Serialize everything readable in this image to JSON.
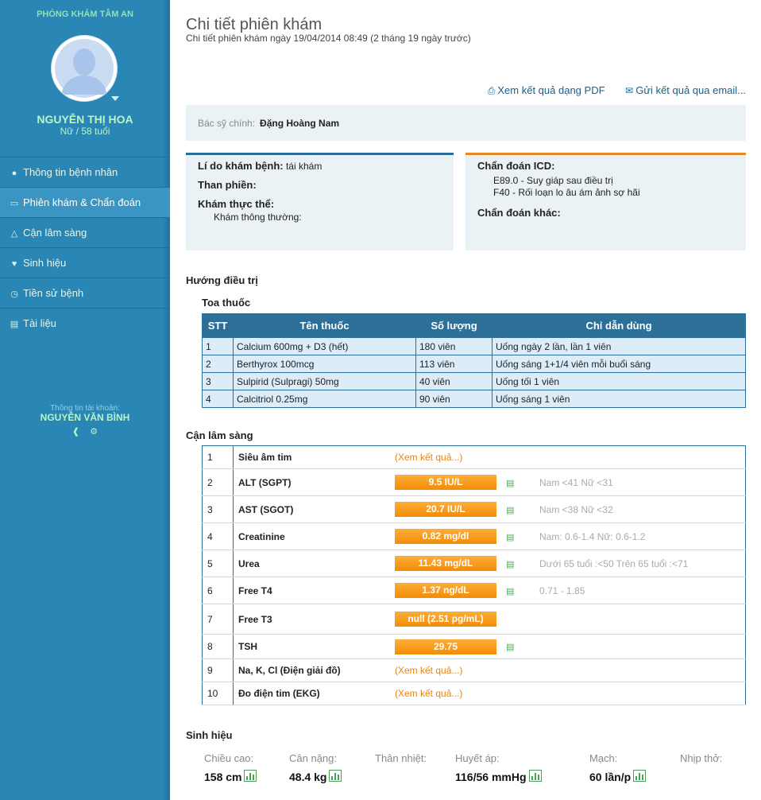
{
  "sidebar": {
    "clinic_name": "PHÒNG KHÁM TÂM AN",
    "patient_name": "NGUYỄN THỊ HOA",
    "patient_sub": "Nữ / 58 tuổi",
    "nav": [
      {
        "label": "Thông tin bệnh nhân",
        "icon": "user-icon"
      },
      {
        "label": "Phiên khám & Chẩn đoán",
        "icon": "folder-open-icon",
        "active": true
      },
      {
        "label": "Cận lâm sàng",
        "icon": "flask-icon"
      },
      {
        "label": "Sinh hiệu",
        "icon": "heart-icon"
      },
      {
        "label": "Tiền sử bệnh",
        "icon": "clock-icon"
      },
      {
        "label": "Tài liệu",
        "icon": "file-icon"
      }
    ],
    "account_label": "Thông tin tài khoản:",
    "account_name": "NGUYỄN VĂN BÌNH"
  },
  "header": {
    "title": "Chi tiết phiên khám",
    "subtitle": "Chi tiết phiên khám ngày 19/04/2014 08:49 (2 tháng 19 ngày trước)",
    "pdf_label": "Xem kết quả dạng PDF",
    "email_label": "Gửi kết quả qua email..."
  },
  "doctor": {
    "label": "Bác sỹ chính:",
    "value": "Đặng Hoàng Nam"
  },
  "exam": {
    "reason_label": "Lí do khám bệnh:",
    "reason_value": "tái khám",
    "complaint_label": "Than phiền:",
    "physical_label": "Khám thực thể:",
    "physical_value": "Khám thông thường:"
  },
  "diagnosis": {
    "icd_label": "Chẩn đoán ICD:",
    "icd_items": [
      "E89.0 - Suy giáp sau điều trị",
      "F40 - Rối loạn lo âu ám ảnh sợ hãi"
    ],
    "other_label": "Chẩn đoán khác:"
  },
  "treatment": {
    "title": "Hướng điều trị",
    "rx_title": "Toa thuốc",
    "columns": [
      "STT",
      "Tên thuốc",
      "Số lượng",
      "Chỉ dẫn dùng"
    ],
    "rows": [
      [
        "1",
        "Calcium 600mg + D3 (hết)",
        "180 viên",
        "Uống ngày 2 lần, lần 1 viên"
      ],
      [
        "2",
        "Berthyrox 100mcg",
        "113 viên",
        "Uống sáng 1+1/4 viên mỗi buổi sáng"
      ],
      [
        "3",
        "Sulpirid (Sulpragi) 50mg",
        "40 viên",
        "Uống tối 1 viên"
      ],
      [
        "4",
        "Calcitriol 0.25mg",
        "90 viên",
        "Uống sáng 1 viên"
      ]
    ]
  },
  "labs": {
    "title": "Cận lâm sàng",
    "rows": [
      {
        "stt": "1",
        "name": "Siêu âm tim",
        "link": "(Xem kết quả...)"
      },
      {
        "stt": "2",
        "name": "ALT (SGPT)",
        "result": "9.5 IU/L",
        "chart": true,
        "ref": "Nam <41 Nữ <31"
      },
      {
        "stt": "3",
        "name": "AST (SGOT)",
        "result": "20.7 IU/L",
        "chart": true,
        "ref": "Nam <38 Nữ <32"
      },
      {
        "stt": "4",
        "name": "Creatinine",
        "result": "0.82 mg/dl",
        "chart": true,
        "ref": "Nam: 0.6-1.4 Nữ: 0.6-1.2"
      },
      {
        "stt": "5",
        "name": "Urea",
        "result": "11.43 mg/dL",
        "chart": true,
        "ref": "Dưới 65 tuổi :<50 Trên 65 tuổi :<71"
      },
      {
        "stt": "6",
        "name": "Free T4",
        "result": "1.37 ng/dL",
        "chart": true,
        "ref": "0.71 - 1.85"
      },
      {
        "stt": "7",
        "name": "Free T3",
        "result": "null (2.51 pg/mL)"
      },
      {
        "stt": "8",
        "name": "TSH",
        "result": "29.75",
        "chart": true
      },
      {
        "stt": "9",
        "name": "Na, K, Cl (Điện giải đồ)",
        "link": "(Xem kết quả...)"
      },
      {
        "stt": "10",
        "name": "Đo điện tim (EKG)",
        "link": "(Xem kết quả...)"
      }
    ]
  },
  "vitals": {
    "title": "Sinh hiệu",
    "items": [
      {
        "label": "Chiều cao:",
        "value": "158 cm",
        "chart": true
      },
      {
        "label": "Cân nặng:",
        "value": "48.4 kg",
        "chart": true
      },
      {
        "label": "Thân nhiệt:",
        "value": ""
      },
      {
        "label": "Huyết áp:",
        "value": "116/56 mmHg",
        "chart": true
      },
      {
        "label": "Mạch:",
        "value": "60 lần/p",
        "chart": true
      },
      {
        "label": "Nhịp thở:",
        "value": ""
      }
    ]
  }
}
